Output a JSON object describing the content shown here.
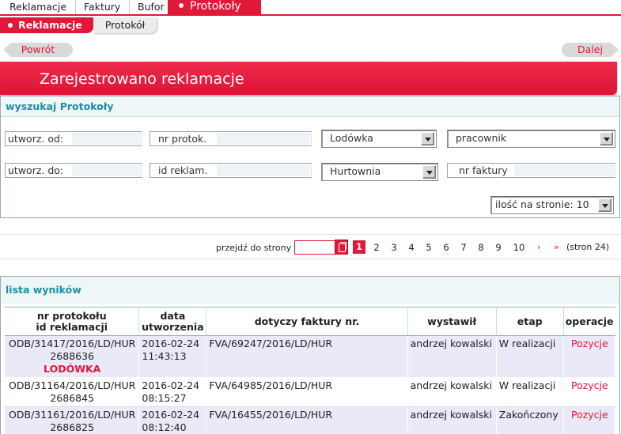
{
  "top_tabs": [
    "Reklamacje",
    "Faktury",
    "Bufor",
    "Protokoły"
  ],
  "sub_tabs": [
    "Reklamacje",
    "Protokół"
  ],
  "nav": {
    "back": "Powrót",
    "next": "Dalej"
  },
  "banner_title": "Zarejestrowano reklamacje",
  "search": {
    "title": "wyszukaj Protokoły",
    "created_from": "utworz. od:",
    "created_to": "utworz. do:",
    "protocol_no": "nr protok.",
    "complaint_id": "id reklam.",
    "category_select": "Lodówka",
    "source_select": "Hurtownia",
    "employee_select": "pracownik",
    "invoice_no": "nr faktury",
    "per_page": "ilość na stronie: 10"
  },
  "pager": {
    "goto_label": "przejdź do strony",
    "current": "1",
    "pages": [
      "2",
      "3",
      "4",
      "5",
      "6",
      "7",
      "8",
      "9",
      "10"
    ],
    "next": "›",
    "last": "»",
    "total": "(stron 24)"
  },
  "results": {
    "title": "lista wyników",
    "headers": {
      "col1_line1": "nr protokołu",
      "col1_line2": "id reklamacji",
      "col2_line1": "data",
      "col2_line2": "utworzenia",
      "col3": "dotyczy faktury nr.",
      "col4": "wystawił",
      "col5": "etap",
      "col6": "operacje"
    },
    "rows": [
      {
        "protocol": "ODB/31417/2016/LD/HUR",
        "id": "2688636",
        "tag": "LODÓWKA",
        "date": "2016-02-24",
        "time": "11:43:13",
        "invoice": "FVA/69247/2016/LD/HUR",
        "issuer": "andrzej kowalski",
        "stage": "W realizacji",
        "op": "Pozycje"
      },
      {
        "protocol": "ODB/31164/2016/LD/HUR",
        "id": "2686845",
        "date": "2016-02-24",
        "time": "08:15:27",
        "invoice": "FVA/64985/2016/LD/HUR",
        "issuer": "andrzej kowalski",
        "stage": "W realizacji",
        "op": "Pozycje"
      },
      {
        "protocol": "ODB/31161/2016/LD/HUR",
        "id": "2686825",
        "date": "2016-02-24",
        "time": "08:12:40",
        "invoice": "FVA/16455/2016/LD/HUR",
        "issuer": "andrzej kowalski",
        "stage": "Zakończony",
        "op": "Pozycje"
      }
    ]
  },
  "colors": {
    "accent": "#e0183a",
    "panel_title": "#1b8fa5",
    "row_alt": "#e9e9f7"
  }
}
